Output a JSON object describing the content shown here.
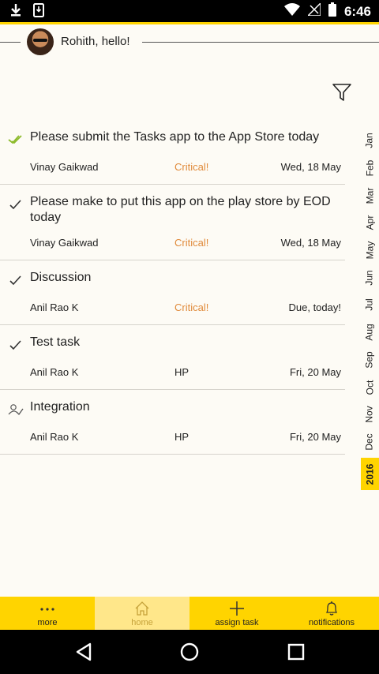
{
  "status_bar": {
    "time": "6:46",
    "icons": [
      "download-icon",
      "phone-download-icon",
      "wifi-icon",
      "no-signal-icon",
      "battery-icon"
    ]
  },
  "header": {
    "greeting": "Rohith, hello!"
  },
  "tasks": [
    {
      "title": "Please submit the Tasks app to the App Store today",
      "assignee": "Vinay Gaikwad",
      "priority": "Critical!",
      "due": "Wed, 18 May",
      "status_icon": "double-check-icon"
    },
    {
      "title": "Please make to put this app on the play store by EOD today",
      "assignee": "Vinay Gaikwad",
      "priority": "Critical!",
      "due": "Wed, 18 May",
      "status_icon": "check-icon"
    },
    {
      "title": "Discussion",
      "assignee": "Anil Rao K",
      "priority": "Critical!",
      "due": "Due, today!",
      "status_icon": "check-icon"
    },
    {
      "title": "Test task",
      "assignee": "Anil Rao K",
      "priority": "HP",
      "due": "Fri, 20 May",
      "status_icon": "check-icon"
    },
    {
      "title": "Integration",
      "assignee": "Anil Rao K",
      "priority": "HP",
      "due": "Fri, 20 May",
      "status_icon": "user-check-icon"
    }
  ],
  "months": [
    "Jan",
    "Feb",
    "Mar",
    "Apr",
    "May",
    "Jun",
    "Jul",
    "Aug",
    "Sep",
    "Oct",
    "Nov",
    "Dec"
  ],
  "year": "2016",
  "tabbar": {
    "more": "more",
    "home": "home",
    "assign_task": "assign task",
    "notifications": "notifications",
    "active": "home"
  },
  "colors": {
    "accent": "#ffd400",
    "critical": "#e08a3a",
    "check_green": "#8dbb2c"
  }
}
